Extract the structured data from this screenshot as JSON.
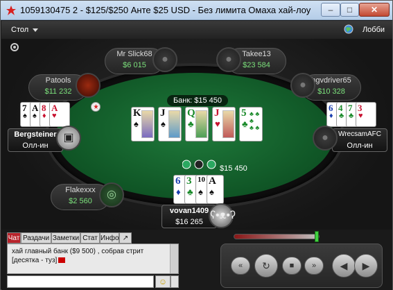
{
  "window": {
    "title": "1059130475 2 - $125/$250 Анте $25 USD - Без лимита Омаха хай-лоу",
    "minimize": "–",
    "maximize": "□",
    "close": "✕"
  },
  "topbar": {
    "table_menu": "Стол",
    "lobby": "Лобби"
  },
  "table": {
    "pot": "Банк: $15 450",
    "board": [
      {
        "rank": "K",
        "suit": "♠",
        "color": "black"
      },
      {
        "rank": "J",
        "suit": "♠",
        "color": "black"
      },
      {
        "rank": "Q",
        "suit": "♣",
        "color": "green"
      },
      {
        "rank": "J",
        "suit": "♥",
        "color": "red"
      },
      {
        "rank": "5",
        "suit": "♣",
        "color": "green"
      }
    ],
    "chips_amount": "$15 450"
  },
  "seats": [
    {
      "name": "Mr Slick68",
      "stack": "$6 015"
    },
    {
      "name": "Takee13",
      "stack": "$23 584"
    },
    {
      "name": "Patools",
      "stack": "$11 232"
    },
    {
      "name": "hgvdriver65",
      "stack": "$10 328"
    },
    {
      "name": "Flakexxx",
      "stack": "$2 560"
    }
  ],
  "players": {
    "left": {
      "name": "Bergsteiner",
      "status": "Олл-ин",
      "cards": [
        {
          "rank": "7",
          "suit": "♠",
          "color": "black"
        },
        {
          "rank": "A",
          "suit": "♠",
          "color": "black"
        },
        {
          "rank": "8",
          "suit": "♦",
          "color": "red"
        },
        {
          "rank": "A",
          "suit": "♥",
          "color": "red"
        }
      ]
    },
    "right": {
      "name": "WrecsamAFC",
      "status": "Олл-ин",
      "cards": [
        {
          "rank": "6",
          "suit": "♦",
          "color": "blue"
        },
        {
          "rank": "4",
          "suit": "♣",
          "color": "green"
        },
        {
          "rank": "7",
          "suit": "♣",
          "color": "green"
        },
        {
          "rank": "3",
          "suit": "♥",
          "color": "red"
        }
      ]
    },
    "hero": {
      "name": "vovan1409",
      "stack": "$16 265",
      "cards": [
        {
          "rank": "6",
          "suit": "♦",
          "color": "blue"
        },
        {
          "rank": "3",
          "suit": "♣",
          "color": "green"
        },
        {
          "rank": "10",
          "suit": "♠",
          "color": "black"
        },
        {
          "rank": "A",
          "suit": "♠",
          "color": "black"
        }
      ]
    }
  },
  "chat": {
    "tabs": [
      "Чат",
      "Раздачи",
      "Заметки",
      "Стат",
      "Инфо",
      "↗"
    ],
    "message": "хай главный банк ($9 500) , собрав стрит [десятка - туз]",
    "input_value": "",
    "emoji": "☺"
  },
  "replay": {
    "buttons": [
      "«",
      "↻",
      "■",
      "»"
    ],
    "nav_back": "◀",
    "nav_forward": "▶"
  },
  "colors": {
    "felt": "#1f7a3b",
    "stack_green": "#7be07b",
    "active_tab": "#b8232b"
  }
}
